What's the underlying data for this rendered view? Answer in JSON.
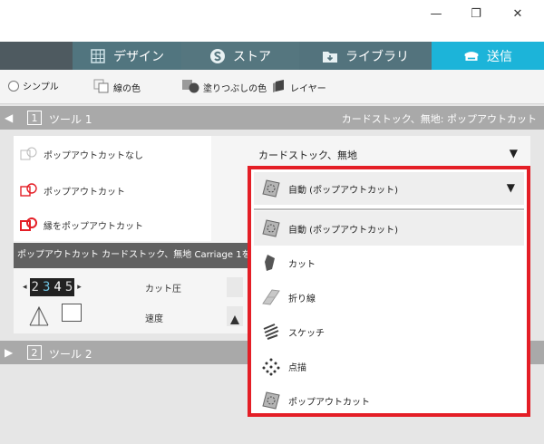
{
  "window": {
    "minimize_glyph": "—",
    "maximize_glyph": "❐",
    "close_glyph": "✕"
  },
  "nav": {
    "tabs": [
      {
        "label": "デザイン",
        "icon": "grid-icon"
      },
      {
        "label": "ストア",
        "icon": "store-s-icon"
      },
      {
        "label": "ライブラリ",
        "icon": "library-folder-icon"
      },
      {
        "label": "送信",
        "icon": "send-machine-icon"
      }
    ],
    "active_color": "#1cb4d9"
  },
  "modebar": {
    "items": [
      {
        "label": "シンプル",
        "icon": "radio-icon"
      },
      {
        "label": "線の色",
        "icon": "line-color-icon"
      },
      {
        "label": "塗りつぶしの色",
        "icon": "fill-color-icon"
      },
      {
        "label": "レイヤー",
        "icon": "layer-icon"
      }
    ]
  },
  "tool1": {
    "number": "1",
    "name": "ツール 1",
    "material": "カードストック、無地: ポップアウトカット"
  },
  "tool2": {
    "number": "2",
    "name": "ツール 2"
  },
  "popout": {
    "options": [
      {
        "label": "ポップアウトカットなし",
        "icon": "no-popout-icon"
      },
      {
        "label": "ポップアウトカット",
        "icon": "popout-icon"
      },
      {
        "label": "縁をポップアウトカット",
        "icon": "edge-popout-icon"
      }
    ]
  },
  "infobar": {
    "text": "ポップアウトカット カードストック、無地 Carriage 1を"
  },
  "settings": {
    "pressure_label": "カット圧",
    "speed_label": "速度",
    "digits": [
      "2",
      "3",
      "4",
      "5"
    ]
  },
  "material_select": {
    "value": "カードストック、無地"
  },
  "action_dropdown": {
    "selected": "自動 (ポップアウトカット)",
    "options": [
      {
        "label": "自動 (ポップアウトカット)",
        "icon": "auto-popout-icon"
      },
      {
        "label": "カット",
        "icon": "blade-icon"
      },
      {
        "label": "折り線",
        "icon": "fold-line-icon"
      },
      {
        "label": "スケッチ",
        "icon": "sketch-icon"
      },
      {
        "label": "点描",
        "icon": "dots-icon"
      },
      {
        "label": "ポップアウトカット",
        "icon": "popout-cut-icon"
      }
    ],
    "highlight_color": "#e41e26"
  }
}
